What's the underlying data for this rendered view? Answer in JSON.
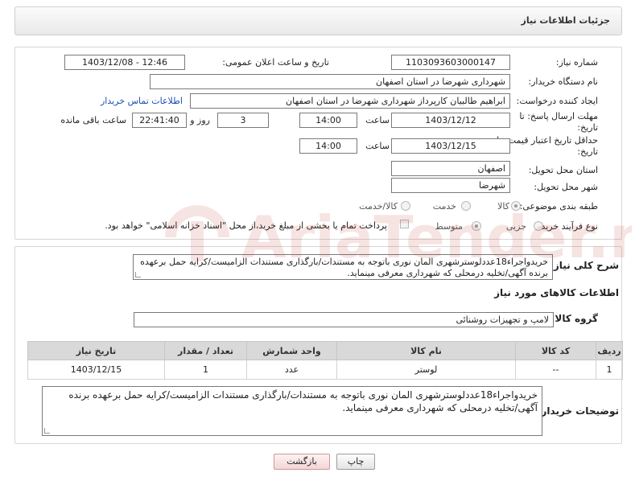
{
  "header": {
    "title": "جزئیات اطلاعات نیاز"
  },
  "form": {
    "need_number_label": "شماره نیاز:",
    "need_number": "1103093603000147",
    "announce_label": "تاریخ و ساعت اعلان عمومی:",
    "announce_value": "1403/12/08 - 12:46",
    "buyer_org_label": "نام دستگاه خریدار:",
    "buyer_org": "شهرداری شهرضا در استان اصفهان",
    "creator_label": "ایجاد کننده درخواست:",
    "creator": "ابراهیم طالبیان کارپرداز شهرداری شهرضا در استان اصفهان",
    "contact_link": "اطلاعات تماس خریدار",
    "reply_deadline_label_1": "مهلت ارسال پاسخ: تا",
    "reply_deadline_label_2": "تاریخ:",
    "reply_date": "1403/12/12",
    "time_label": "ساعت",
    "reply_time": "14:00",
    "days_value": "3",
    "days_label": "روز و",
    "remaining_time": "22:41:40",
    "remaining_label": "ساعت باقی مانده",
    "validity_label_1": "حداقل تاریخ اعتبار قیمت: تا",
    "validity_label_2": "تاریخ:",
    "validity_date": "1403/12/15",
    "validity_time": "14:00",
    "province_label": "استان محل تحویل:",
    "province": "اصفهان",
    "city_label": "شهر محل تحویل:",
    "city": "شهرضا",
    "category_label": "طبقه بندی موضوعی:",
    "category_options": [
      "کالا",
      "خدمت",
      "کالا/خدمت"
    ],
    "purchase_type_label": "نوع فرآیند خرید :",
    "purchase_options": [
      "جزیی",
      "متوسط"
    ],
    "payment_note": "پرداخت تمام یا بخشی از مبلغ خرید،از محل \"اسناد خزانه اسلامی\" خواهد بود."
  },
  "details": {
    "general_desc_label": "شرح کلی نیاز:",
    "general_desc": "خریدواجراء18عددلوسترشهری المان نوری باتوجه به مستندات/بارگذاری مستندات الزامیست/کرایه حمل برعهده برنده آگهی/تخلیه درمحلی که شهرداری معرفی مینماید.",
    "goods_info_title": "اطلاعات کالاهای مورد نیاز",
    "goods_group_label": "گروه کالا:",
    "goods_group": "لامپ و تجهیزات روشنائی",
    "table": {
      "headers": [
        "ردیف",
        "کد کالا",
        "نام کالا",
        "واحد شمارش",
        "تعداد / مقدار",
        "تاریخ نیاز"
      ],
      "rows": [
        [
          "1",
          "--",
          "لوستر",
          "عدد",
          "1",
          "1403/12/15"
        ]
      ]
    },
    "buyer_desc_label": "توضیحات خریدار:",
    "buyer_desc": "خریدواجراء18عددلوسترشهری المان نوری باتوجه به مستندات/بارگذاری مستندات الزامیست/کرایه حمل برعهده برنده آگهی/تخلیه درمحلی که شهرداری معرفی مینماید."
  },
  "buttons": {
    "print": "چاپ",
    "back": "بازگشت"
  },
  "watermark": {
    "text": "AriaTender.neT"
  }
}
